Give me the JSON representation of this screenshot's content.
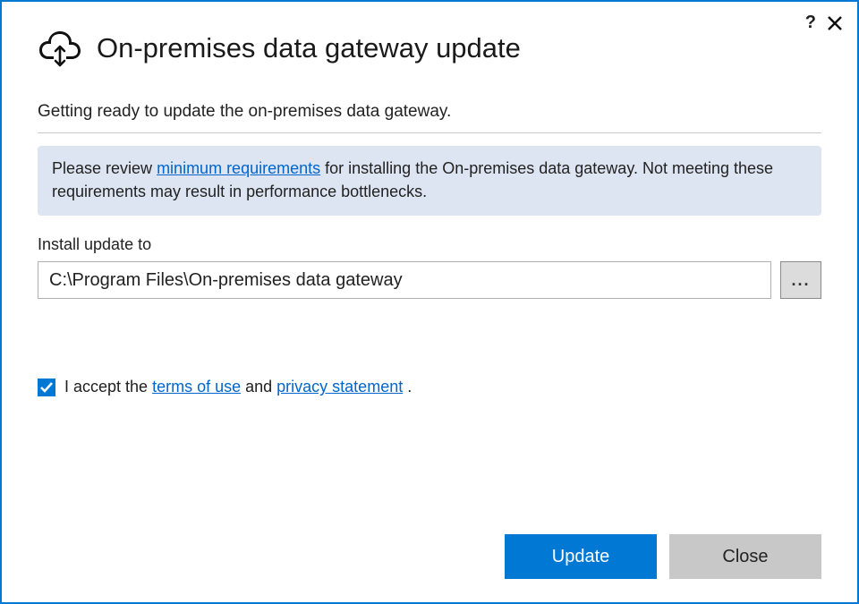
{
  "title": "On-premises data gateway update",
  "subtitle": "Getting ready to update the on-premises data gateway.",
  "notice": {
    "before": "Please review ",
    "link": "minimum requirements",
    "after": " for installing the On-premises data gateway. Not meeting these requirements may result in performance bottlenecks."
  },
  "install": {
    "label": "Install update to",
    "path": "C:\\Program Files\\On-premises data gateway",
    "browse": "..."
  },
  "accept": {
    "before": "I accept the ",
    "terms": "terms of use",
    "mid": " and ",
    "privacy": "privacy statement",
    "after": " .",
    "checked": true
  },
  "buttons": {
    "primary": "Update",
    "secondary": "Close"
  }
}
